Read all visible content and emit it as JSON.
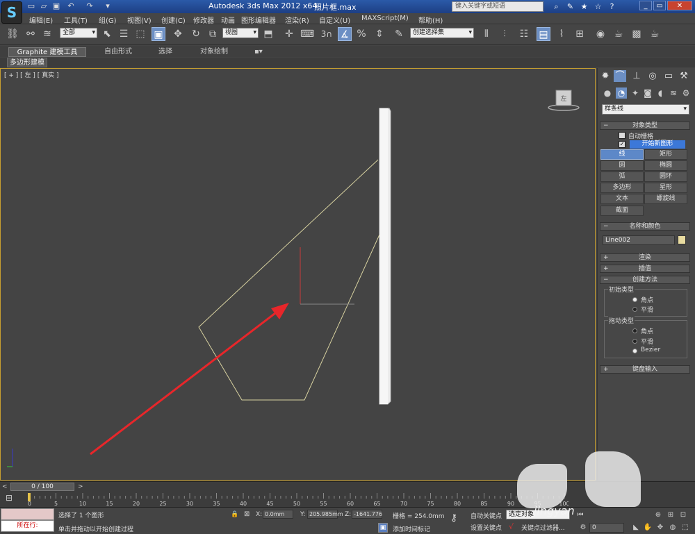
{
  "titlebar": {
    "app_title": "Autodesk 3ds Max  2012 x64",
    "file_name": "照片框.max",
    "search_placeholder": "键入关键字或短语"
  },
  "menu": [
    "编辑(E)",
    "工具(T)",
    "组(G)",
    "视图(V)",
    "创建(C)",
    "修改器",
    "动画",
    "图形编辑器",
    "渲染(R)",
    "自定义(U)",
    "MAXScript(M)",
    "帮助(H)"
  ],
  "toolbar": {
    "selection_filter": "全部",
    "ref_coord": "视图",
    "snap_label": "3",
    "named_selection": "创建选择集"
  },
  "ribbon": {
    "tabs": [
      "Graphite 建模工具",
      "自由形式",
      "选择",
      "对象绘制"
    ],
    "sub_tab": "多边形建模"
  },
  "viewport": {
    "label": "[ + ] [ 左 ] [ 真实 ]",
    "viewcube_face": "左"
  },
  "command_panel": {
    "category": "样条线",
    "object_type": {
      "title": "对象类型",
      "autogrid": "自动栅格",
      "start_new_shape": "开始新图形",
      "buttons": [
        "线",
        "矩形",
        "圆",
        "椭圆",
        "弧",
        "圆环",
        "多边形",
        "星形",
        "文本",
        "螺旋线",
        "截面"
      ]
    },
    "name_color": {
      "title": "名称和颜色",
      "name": "Line002",
      "swatch_color": "#e8dba0"
    },
    "rollouts": [
      "渲染",
      "插值"
    ],
    "creation_method": {
      "title": "创建方法",
      "initial_type": "初始类型",
      "initial_options": [
        "角点",
        "平滑"
      ],
      "drag_type": "拖动类型",
      "drag_options": [
        "角点",
        "平滑",
        "Bezier"
      ]
    },
    "keyboard_entry": "键盘输入"
  },
  "timeline": {
    "frame_display": "0 / 100",
    "ticks": [
      5,
      10,
      15,
      20,
      25,
      30,
      35,
      40,
      45,
      50,
      55,
      60,
      65,
      70,
      75,
      80,
      85,
      90,
      95,
      100
    ],
    "first_tick": "0"
  },
  "status": {
    "maxscript_prompt": "所在行:",
    "message": "选择了 1 个图形",
    "prompt": "单击并拖动以开始创建过程",
    "x_label": "X:",
    "x_value": "0.0mm",
    "y_label": "Y:",
    "y_value": "205.985mm",
    "z_label": "Z:",
    "z_value": "-1641.776",
    "grid": "栅格 = 254.0mm",
    "add_time_tag": "添加时间标记",
    "auto_key": "自动关键点",
    "set_key": "设置关键点",
    "selected_dd": "选定对象",
    "key_filters": "关键点过滤器...",
    "frame_value": "0"
  },
  "watermark": "jingyan"
}
